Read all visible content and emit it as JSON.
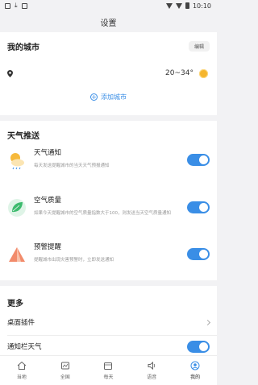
{
  "status_bar": {
    "time": "10:10"
  },
  "app_bar": {
    "title": "设置"
  },
  "my_city": {
    "title": "我的城市",
    "edit_label": "编辑",
    "temperature": "20~34°",
    "add_city_label": "添加城市"
  },
  "weather_push": {
    "title": "天气推送",
    "items": [
      {
        "label": "天气通知",
        "desc": "每天发送提醒城市的当天天气预报通知",
        "enabled": true
      },
      {
        "label": "空气质量",
        "desc": "如果今天提醒城市的空气质量指数大于100，则发送当天空气质量通知",
        "enabled": true
      },
      {
        "label": "预警提醒",
        "desc": "提醒城市出现灾害预警时，立即发送通知",
        "enabled": true
      }
    ]
  },
  "more": {
    "title": "更多",
    "desktop_widget_label": "桌面插件",
    "notification_bar_label": "通知栏天气",
    "notification_bar_enabled": true
  },
  "tabs": [
    {
      "label": "当地",
      "icon": "home-icon"
    },
    {
      "label": "全国",
      "icon": "map-icon"
    },
    {
      "label": "每天",
      "icon": "calendar-icon"
    },
    {
      "label": "语音",
      "icon": "speaker-icon"
    },
    {
      "label": "我的",
      "icon": "profile-icon",
      "active": true
    }
  ],
  "colors": {
    "accent": "#3a8ee6",
    "sun": "#f5b52e"
  }
}
